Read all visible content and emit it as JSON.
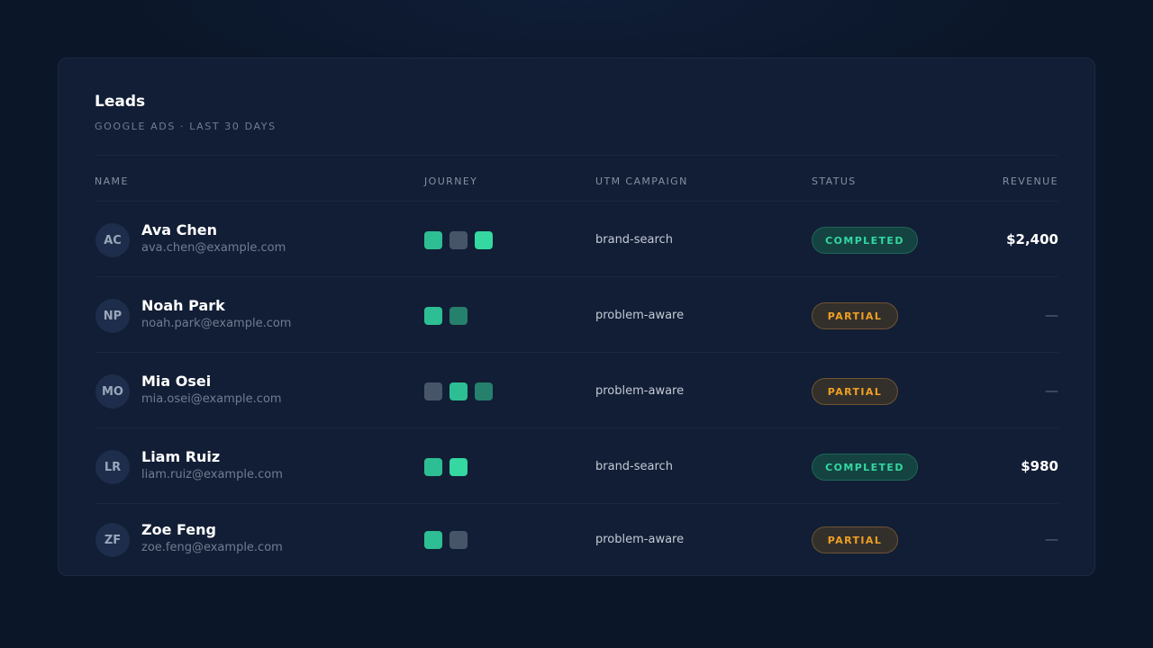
{
  "card": {
    "title": "Leads",
    "subtitle": "GOOGLE ADS · LAST 30 DAYS"
  },
  "table": {
    "headers": {
      "name": "NAME",
      "journey": "JOURNEY",
      "utm": "UTM CAMPAIGN",
      "status": "STATUS",
      "revenue": "REVENUE"
    },
    "rows": [
      {
        "initials": "AC",
        "name": "Ava Chen",
        "email": "ava.chen@example.com",
        "journey": [
          "teal",
          "gray",
          "bright"
        ],
        "utm": "brand-search",
        "status": "COMPLETED",
        "status_type": "completed",
        "revenue": "$2,400"
      },
      {
        "initials": "NP",
        "name": "Noah Park",
        "email": "noah.park@example.com",
        "journey": [
          "teal",
          "dark"
        ],
        "utm": "problem-aware",
        "status": "PARTIAL",
        "status_type": "partial",
        "revenue": "—"
      },
      {
        "initials": "MO",
        "name": "Mia Osei",
        "email": "mia.osei@example.com",
        "journey": [
          "gray",
          "teal",
          "dark"
        ],
        "utm": "problem-aware",
        "status": "PARTIAL",
        "status_type": "partial",
        "revenue": "—"
      },
      {
        "initials": "LR",
        "name": "Liam Ruiz",
        "email": "liam.ruiz@example.com",
        "journey": [
          "teal",
          "bright"
        ],
        "utm": "brand-search",
        "status": "COMPLETED",
        "status_type": "completed",
        "revenue": "$980"
      },
      {
        "initials": "ZF",
        "name": "Zoe Feng",
        "email": "zoe.feng@example.com",
        "journey": [
          "teal",
          "gray"
        ],
        "utm": "problem-aware",
        "status": "PARTIAL",
        "status_type": "partial",
        "revenue": "—"
      }
    ]
  },
  "colors": {
    "background": "#0b1628",
    "card": "#121e35",
    "accent_completed": "#34d8a0",
    "accent_partial": "#f0a020",
    "journey_teal": "#2dbf93",
    "journey_bright": "#34d8a0",
    "journey_dark": "#25806c",
    "journey_gray": "#475569"
  }
}
